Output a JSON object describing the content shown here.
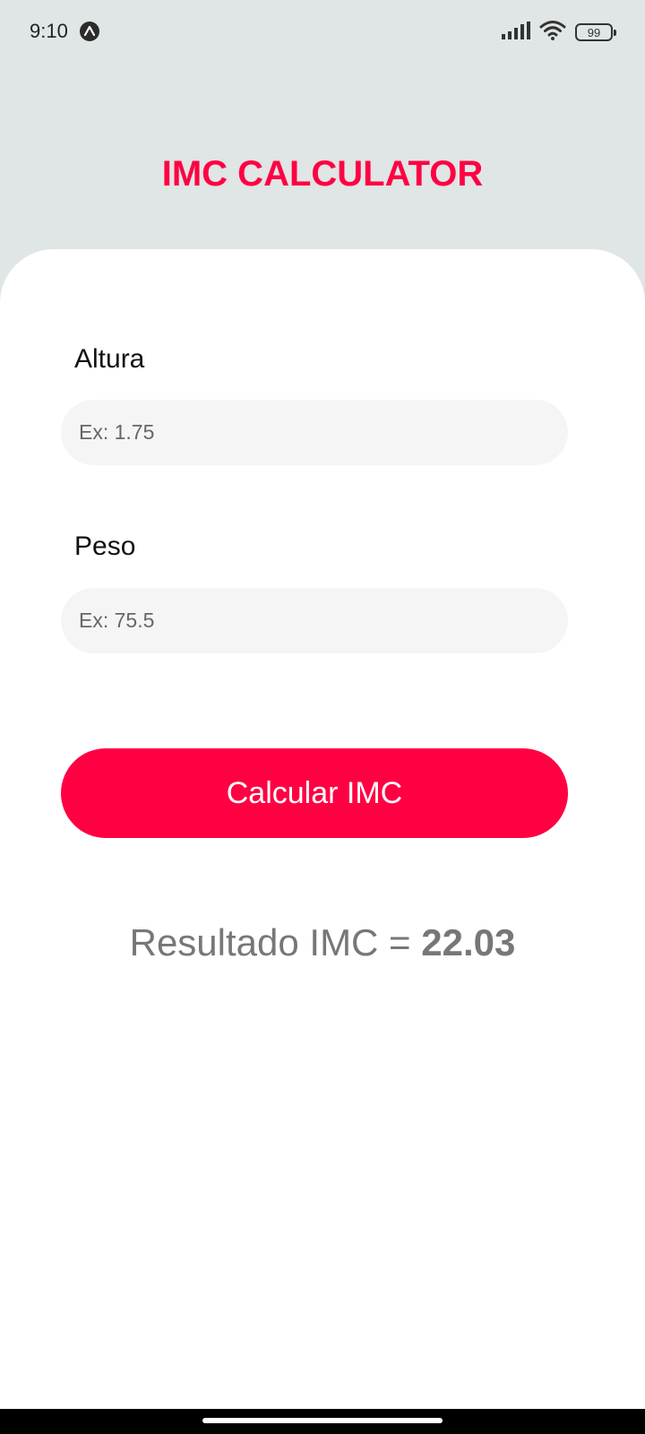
{
  "status_bar": {
    "time": "9:10",
    "battery": "99",
    "icons": [
      "signal-icon",
      "wifi-icon",
      "battery-icon"
    ]
  },
  "header": {
    "title": "IMC CALCULATOR"
  },
  "form": {
    "height": {
      "label": "Altura",
      "placeholder": "Ex: 1.75",
      "value": ""
    },
    "weight": {
      "label": "Peso",
      "placeholder": "Ex: 75.5",
      "value": ""
    },
    "button_label": "Calcular IMC"
  },
  "result": {
    "label": "Resultado IMC = ",
    "value": "22.03"
  },
  "colors": {
    "accent": "#ff0043",
    "header_bg": "#e0e5e5",
    "card_bg": "#ffffff",
    "input_bg": "#f5f5f5",
    "result_text": "#777777"
  }
}
